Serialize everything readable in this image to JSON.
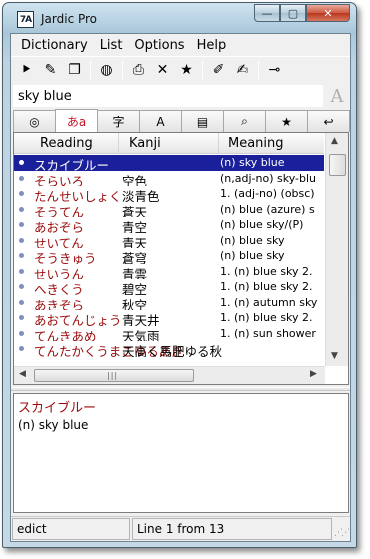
{
  "window": {
    "title": "Jardic Pro",
    "icon_label": "7A"
  },
  "caption_buttons": [
    "—",
    "▢",
    "✕"
  ],
  "menu": [
    "Dictionary",
    "List",
    "Options",
    "Help"
  ],
  "toolbar": [
    {
      "icon": "bookmark-icon",
      "glyph": "⯈"
    },
    {
      "icon": "brush-icon",
      "glyph": "✎"
    },
    {
      "icon": "copy-icon",
      "glyph": "❐"
    },
    {
      "sep": true
    },
    {
      "icon": "globe-icon",
      "glyph": "◍"
    },
    {
      "sep": true
    },
    {
      "icon": "print-icon",
      "glyph": "⎙"
    },
    {
      "icon": "delete-icon",
      "glyph": "✕"
    },
    {
      "icon": "star-icon",
      "glyph": "★"
    },
    {
      "sep": true
    },
    {
      "icon": "notes-icon",
      "glyph": "✐"
    },
    {
      "icon": "edit-notes-icon",
      "glyph": "✍"
    },
    {
      "sep": true
    },
    {
      "icon": "pin-icon",
      "glyph": "⊸"
    }
  ],
  "search": {
    "value": "sky blue",
    "icon_glyph": "A"
  },
  "tabs": [
    {
      "name": "tab-chat",
      "label": "◎"
    },
    {
      "name": "tab-hiragana",
      "label": "あa"
    },
    {
      "name": "tab-kanji",
      "label": "字"
    },
    {
      "name": "tab-font",
      "label": "A"
    },
    {
      "name": "tab-document",
      "label": "▤"
    },
    {
      "name": "tab-search",
      "label": "⌕"
    },
    {
      "name": "tab-favorites",
      "label": "★"
    },
    {
      "name": "tab-back",
      "label": "↩"
    }
  ],
  "columns": {
    "reading": "Reading",
    "kanji": "Kanji",
    "meaning": "Meaning"
  },
  "rows": [
    {
      "reading": "スカイブルー",
      "kanji": "",
      "meaning": "(n) sky blue"
    },
    {
      "reading": "そらいろ",
      "kanji": "空色",
      "meaning": "(n,adj-no) sky-blu"
    },
    {
      "reading": "たんせいしょく",
      "kanji": "淡青色",
      "meaning": "1. (adj-no) (obsc)"
    },
    {
      "reading": "そうてん",
      "kanji": "蒼天",
      "meaning": "(n) blue (azure) s"
    },
    {
      "reading": "あおぞら",
      "kanji": "青空",
      "meaning": "(n) blue sky/(P)"
    },
    {
      "reading": "せいてん",
      "kanji": "青天",
      "meaning": "(n) blue sky"
    },
    {
      "reading": "そうきゅう",
      "kanji": "蒼穹",
      "meaning": "(n) blue sky"
    },
    {
      "reading": "せいうん",
      "kanji": "青雲",
      "meaning": "1. (n) blue sky  2."
    },
    {
      "reading": "へきくう",
      "kanji": "碧空",
      "meaning": "1. (n) blue sky  2."
    },
    {
      "reading": "あきぞら",
      "kanji": "秋空",
      "meaning": "1. (n) autumn sky"
    },
    {
      "reading": "あおてんじょう",
      "kanji": "青天井",
      "meaning": "1. (n) blue sky  2."
    },
    {
      "reading": "てんきあめ",
      "kanji": "天気雨",
      "meaning": "1. (n) sun shower"
    },
    {
      "reading": "てんたかくうまこゆるあき",
      "kanji": "天高く馬肥ゆる秋",
      "meaning": ""
    }
  ],
  "detail": {
    "reading": "スカイブルー",
    "meaning": "(n) sky blue"
  },
  "status": {
    "dictionary": "edict",
    "position": "Line 1 from 13"
  }
}
